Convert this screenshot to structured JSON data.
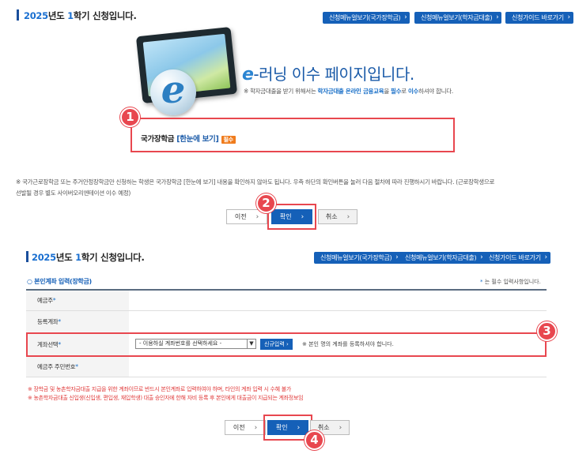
{
  "top": {
    "title_year": "2025",
    "title_mid": "년도 ",
    "title_term": "1",
    "title_rest": "학기 신청입니다.",
    "nav": [
      {
        "label": "신청메뉴얼보기(국가장학금)"
      },
      {
        "label": "신청메뉴얼보기(학자금대출)"
      },
      {
        "label": "신청가이드 바로가기"
      }
    ],
    "hero_e": "e",
    "hero_text": "-러닝 이수 페이지입니다.",
    "hero_sub_1": "※ 학자금대출을 받기 위해서는 ",
    "hero_sub_hl1": "학자금대출 온라인 금융교육",
    "hero_sub_2": "을 ",
    "hero_sub_hl2": "필수",
    "hero_sub_3": "로 ",
    "hero_sub_hl3": "이수",
    "hero_sub_4": "하셔야 합니다.",
    "card_label": "국가장학금 ",
    "card_link": "[한눈에 보기]",
    "card_badge": "필수",
    "notice_1": "※ 국가근로장학금 또는 주거안정장학금만 신청하는 학생은 국가장학금 [한눈에 보기] 내용을 확인하지 않아도 됩니다. 우측 하단의 확인버튼을 눌러 다음 절차에 따라 진행하시기 바랍니다. (근로장학생으로",
    "notice_2": "선발될 경우 별도 사이버오리엔테이션 이수 예정)",
    "btn_prev": "이전",
    "btn_ok": "확인",
    "btn_cancel": "취소",
    "step1": "1",
    "step2": "2"
  },
  "bottom": {
    "title_year": "2025",
    "title_mid": "년도 ",
    "title_term": "1",
    "title_rest": "학기 신청입니다.",
    "nav": [
      {
        "label": "신청메뉴얼보기(국가장학금)"
      },
      {
        "label": "신청메뉴얼보기(학자금대출)"
      },
      {
        "label": "신청가이드 바로가기"
      }
    ],
    "section_title": "본인계좌 입력(장학금)",
    "required_note_star": "*",
    "required_note": " 는 필수 입력사항입니다.",
    "fields": [
      {
        "label": "예금주",
        "star": "*"
      },
      {
        "label": "등록계좌",
        "star": "*"
      },
      {
        "label": "계좌선택",
        "star": "*"
      },
      {
        "label": "예금주 주민번호",
        "star": "*"
      }
    ],
    "select_value": "- 이용하실 계좌번호를 선택하세요 -",
    "new_input_btn": "신규입력",
    "account_hint": "※ 본인 명의 계좌를 등록하셔야 합니다.",
    "warnings": [
      "※ 장학금 및 농촌학자금대출 지급을 위한 계좌이므로 반드시 본인계좌로 입력하여야 하며, 타인의 계좌 입력 시 수혜 불가",
      "※ 농촌학자금대출 신입생(신입생, 편입생, 재입학생) 대출 승인자에 한해 자비 등록 후 본인에게 대출금이 지급되는 계좌정보임"
    ],
    "btn_prev": "이전",
    "btn_ok": "확인",
    "btn_cancel": "취소",
    "step3": "3",
    "step4": "4"
  },
  "colors": {
    "accent": "#1560b8",
    "highlight_box": "#e8474f",
    "badge": "#f07c1d",
    "warning_text": "#e03a3a"
  }
}
